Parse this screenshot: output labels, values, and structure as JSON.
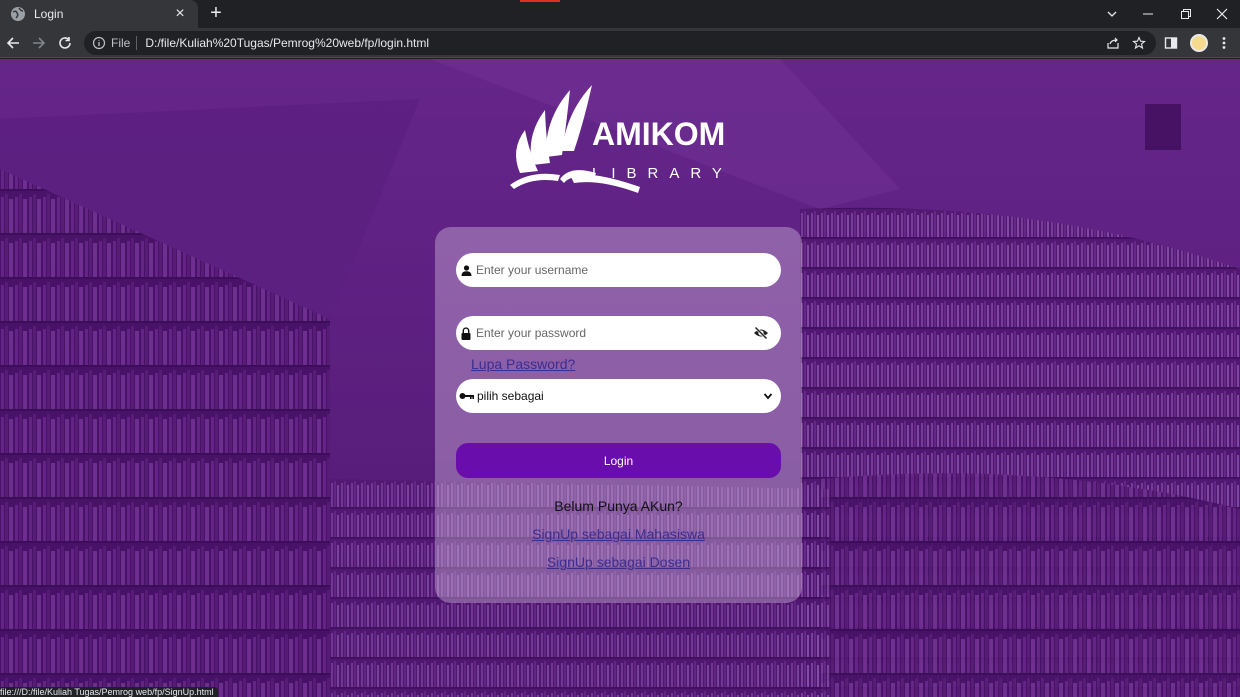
{
  "browser": {
    "tab": {
      "title": "Login"
    },
    "address": {
      "scheme_label": "File",
      "url": "D:/file/Kuliah%20Tugas/Pemrog%20web/fp/login.html"
    }
  },
  "logo": {
    "word": "AMIKOM",
    "subword": "LIBRARY"
  },
  "form": {
    "username_placeholder": "Enter your username",
    "password_placeholder": "Enter your password",
    "forgot_label": "Lupa Password?",
    "role_select_value": "pilih sebagai",
    "login_label": "Login",
    "no_account_text": "Belum Punya AKun?",
    "signup_student_label": "SignUp sebagai Mahasiswa",
    "signup_lecturer_label": "SignUp sebagai Dosen"
  },
  "status_url": "file:///D:/file/Kuliah Tugas/Pemrog web/fp/SignUp.html",
  "colors": {
    "accent": "#6a0dad",
    "page_purple": "#4b1568",
    "link": "#3b2d8f"
  },
  "icons": [
    "globe-icon",
    "close-icon",
    "plus-icon",
    "back-icon",
    "forward-icon",
    "reload-icon",
    "info-icon",
    "share-icon",
    "star-icon",
    "side-panel-icon",
    "menu-icon",
    "user-icon",
    "lock-icon",
    "eye-off-icon",
    "key-icon",
    "chevron-down-icon"
  ]
}
